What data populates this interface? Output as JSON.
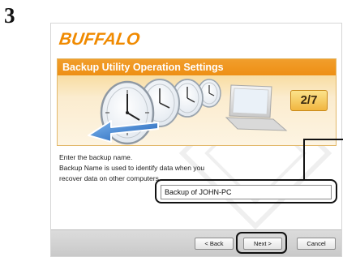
{
  "step_number": "3",
  "brand": {
    "name": "BUFFALO",
    "color": "#f08a00"
  },
  "window": {
    "title": "Backup Utility Operation Settings",
    "step_indicator": "2/7",
    "accent_color": "#ee8f14"
  },
  "instructions": {
    "line1": "Enter the backup name.",
    "line2": "Backup Name is used to identify data when you",
    "line3": "recover data on other computers."
  },
  "backup_name_input": {
    "value": "Backup of JOHN-PC"
  },
  "buttons": {
    "back": "< Back",
    "next": "Next >",
    "cancel": "Cancel"
  },
  "icons": [
    "clock-icon",
    "laptop-icon",
    "arrow-icon"
  ]
}
